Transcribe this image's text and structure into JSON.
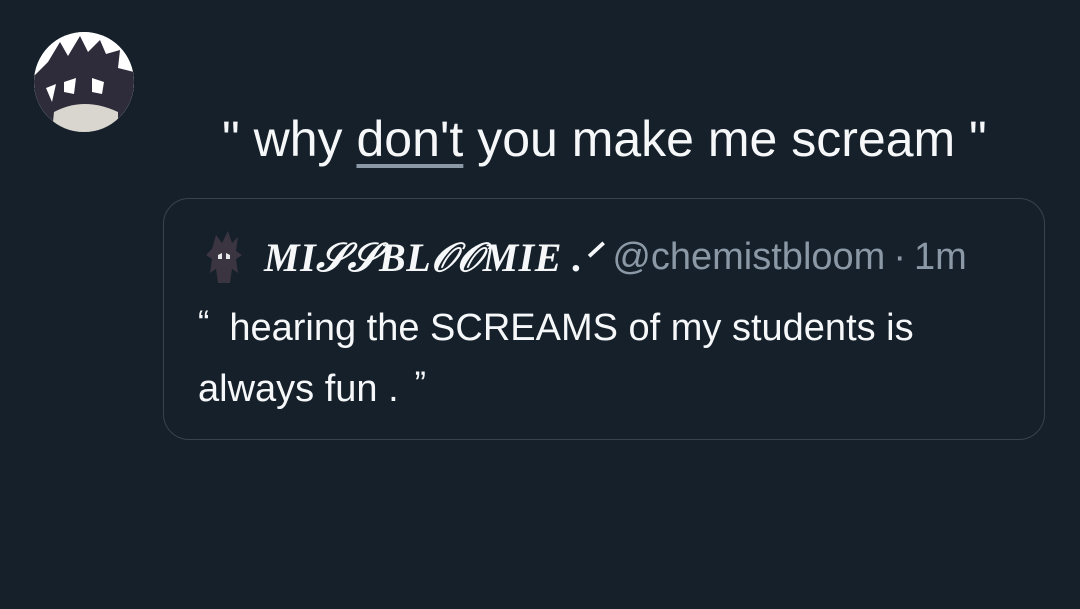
{
  "tweet": {
    "text_before": "\" why ",
    "text_underlined": "don't",
    "text_after": " you make me scream \"",
    "author_avatar_icon": "profile-avatar-icon"
  },
  "quoted_tweet": {
    "avatar_icon": "profile-avatar-icon",
    "display_name": "MI𝒮𝒮BL𝒪𝒪MIE .ᐟ",
    "handle": "@chemistbloom",
    "separator": "·",
    "time": "1m",
    "open_quote": "“",
    "body": "hearing the SCREAMS of my students is always fun .",
    "close_quote": "”"
  },
  "colors": {
    "background": "#15202b",
    "border": "#38444d",
    "text_primary": "#f5f7f8",
    "text_secondary": "#8b98a5"
  }
}
